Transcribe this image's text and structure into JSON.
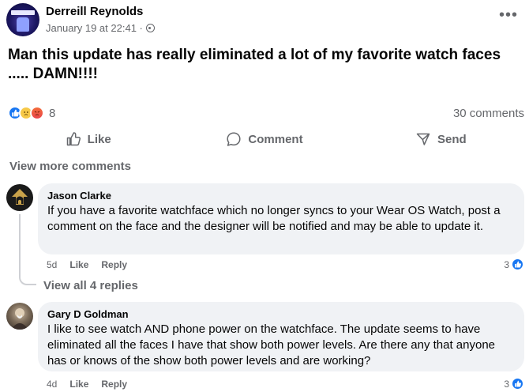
{
  "post": {
    "author": "Derreill Reynolds",
    "timestamp": "January 19 at 22:41 ·",
    "privacy_icon": "globe-icon",
    "text": "Man this update has really eliminated a lot of my favorite watch faces ..... DAMN!!!!",
    "more_icon": "•••",
    "reaction_count": "8",
    "comments_count": "30 comments"
  },
  "actions": {
    "like": "Like",
    "comment": "Comment",
    "send": "Send"
  },
  "view_more_comments": "View more comments",
  "comments": [
    {
      "name": "Jason Clarke",
      "text": "If you have a favorite watchface which no longer syncs to your Wear OS Watch, post a comment on the face and the designer will be notified and may be able to update it.",
      "time": "5d",
      "like": "Like",
      "reply": "Reply",
      "reactions": "3",
      "view_replies": "View all 4 replies"
    },
    {
      "name": "Gary D Goldman",
      "text": "I like to see watch AND phone power on the watchface. The update seems to have eliminated all the faces I have that show both power levels. Are there any that anyone has or knows of the show both power levels and are working?",
      "time": "4d",
      "like": "Like",
      "reply": "Reply",
      "reactions": "3"
    }
  ],
  "colors": {
    "accent": "#1877f2",
    "secondary_text": "#65676b",
    "bubble": "#f0f2f5"
  }
}
